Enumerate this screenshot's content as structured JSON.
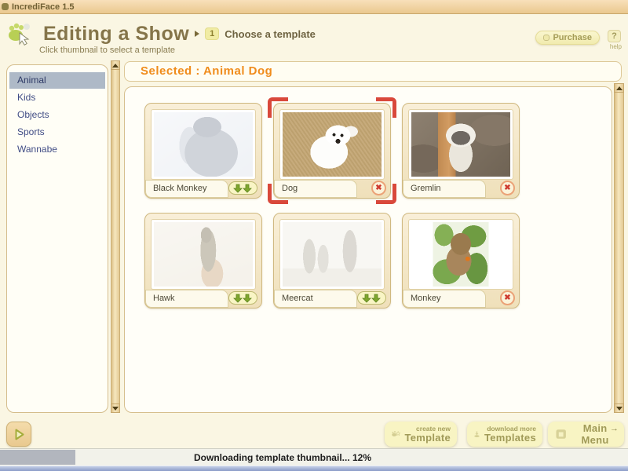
{
  "window": {
    "title": "IncrediFace 1.5"
  },
  "header": {
    "title": "Editing a Show",
    "step_number": "1",
    "step_label": "Choose a template",
    "subtitle": "Click thumbnail to select a template",
    "purchase_label": "Purchase",
    "help_glyph": "?",
    "help_label": "help"
  },
  "sidebar": {
    "categories": [
      {
        "label": "Animal",
        "selected": true
      },
      {
        "label": "Kids",
        "selected": false
      },
      {
        "label": "Objects",
        "selected": false
      },
      {
        "label": "Sports",
        "selected": false
      },
      {
        "label": "Wannabe",
        "selected": false
      }
    ]
  },
  "main": {
    "selected_heading": "Selected : Animal Dog",
    "remove_glyph": "✖",
    "templates": [
      {
        "name": "Black Monkey",
        "action": "download",
        "faded": true,
        "selected": false
      },
      {
        "name": "Dog",
        "action": "remove",
        "faded": false,
        "selected": true
      },
      {
        "name": "Gremlin",
        "action": "remove",
        "faded": false,
        "selected": false
      },
      {
        "name": "Hawk",
        "action": "download",
        "faded": true,
        "selected": false
      },
      {
        "name": "Meercat",
        "action": "download",
        "faded": true,
        "selected": false
      },
      {
        "name": "Monkey",
        "action": "remove",
        "faded": false,
        "selected": false
      }
    ]
  },
  "footer": {
    "create_new": {
      "line1": "create new",
      "line2": "Template"
    },
    "download_more": {
      "line1": "download more",
      "line2": "Templates"
    },
    "main_menu": "Main Menu",
    "main_menu_arrow": "→"
  },
  "statusbar": {
    "text": "Downloading template thumbnail... 12%",
    "progress_percent": 12
  },
  "colors": {
    "accent_orange": "#f08c1c",
    "selection_red": "#d9483b",
    "sidebar_text": "#414d85",
    "sidebar_highlight": "#aeb9c7",
    "olive_text": "#85754a",
    "panel_border": "#d6bf8e",
    "button_bg": "#f8f4c3"
  }
}
